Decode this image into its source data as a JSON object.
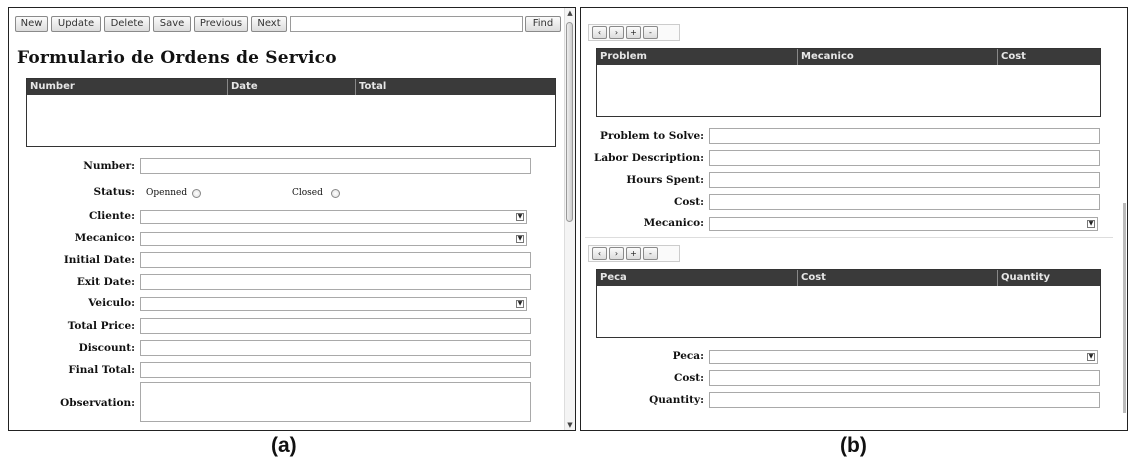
{
  "panel_a": {
    "toolbar": {
      "buttons": [
        "New",
        "Update",
        "Delete",
        "Save",
        "Previous",
        "Next"
      ],
      "search_value": "",
      "find_label": "Find"
    },
    "title": "Formulario de Ordens de Servico",
    "grid": {
      "columns": [
        "Number",
        "Date",
        "Total"
      ],
      "rows": []
    },
    "fields": {
      "number": {
        "label": "Number:",
        "value": ""
      },
      "status": {
        "label": "Status:",
        "options": [
          "Openned",
          "Closed"
        ],
        "selected": ""
      },
      "cliente": {
        "label": "Cliente:",
        "value": ""
      },
      "mecanico": {
        "label": "Mecanico:",
        "value": ""
      },
      "initial_date": {
        "label": "Initial Date:",
        "value": ""
      },
      "exit_date": {
        "label": "Exit Date:",
        "value": ""
      },
      "veiculo": {
        "label": "Veiculo:",
        "value": ""
      },
      "total_price": {
        "label": "Total Price:",
        "value": ""
      },
      "discount": {
        "label": "Discount:",
        "value": ""
      },
      "final_total": {
        "label": "Final Total:",
        "value": ""
      },
      "observation": {
        "label": "Observation:",
        "value": ""
      }
    },
    "caption": "(a)"
  },
  "panel_b": {
    "problems": {
      "nav": [
        "‹",
        "›",
        "+",
        "-"
      ],
      "grid": {
        "columns": [
          "Problem",
          "Mecanico",
          "Cost"
        ],
        "rows": []
      },
      "fields": {
        "problem_to_solve": {
          "label": "Problem to Solve:",
          "value": ""
        },
        "labor_description": {
          "label": "Labor Description:",
          "value": ""
        },
        "hours_spent": {
          "label": "Hours Spent:",
          "value": ""
        },
        "cost": {
          "label": "Cost:",
          "value": ""
        },
        "mecanico": {
          "label": "Mecanico:",
          "value": ""
        }
      }
    },
    "parts": {
      "nav": [
        "‹",
        "›",
        "+",
        "-"
      ],
      "grid": {
        "columns": [
          "Peca",
          "Cost",
          "Quantity"
        ],
        "rows": []
      },
      "fields": {
        "peca": {
          "label": "Peca:",
          "value": ""
        },
        "cost": {
          "label": "Cost:",
          "value": ""
        },
        "quantity": {
          "label": "Quantity:",
          "value": ""
        }
      }
    },
    "caption": "(b)"
  },
  "icons": {
    "select_arrow": "chevron-down-icon",
    "scroll_up": "arrow-up-icon",
    "scroll_down": "arrow-down-icon"
  }
}
